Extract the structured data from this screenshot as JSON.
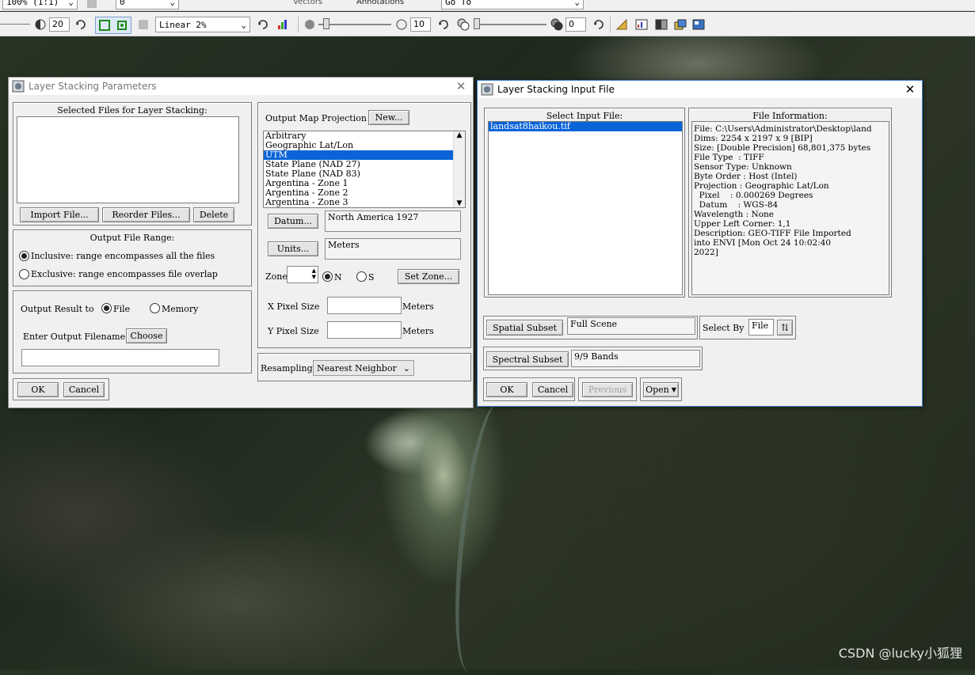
{
  "toolbar_top": {
    "zoom_value": "100% (1:1)",
    "field_value": "0",
    "vectors_label": "Vectors",
    "annotations_label": "Annotations",
    "goto_value": "Go To"
  },
  "toolbar": {
    "brightness_value": "20",
    "stretch_value": "Linear 2%",
    "sharpen_value": "10",
    "transparency_value": "0"
  },
  "params_window": {
    "title": "Layer Stacking Parameters",
    "selected_files_label": "Selected Files for Layer Stacking:",
    "import_button": "Import File...",
    "reorder_button": "Reorder Files...",
    "delete_button": "Delete",
    "output_range_label": "Output File Range:",
    "inclusive_label": "Inclusive: range encompasses all the files",
    "exclusive_label": "Exclusive: range encompasses file overlap",
    "output_result_label": "Output Result to",
    "file_label": "File",
    "memory_label": "Memory",
    "enter_filename_label": "Enter Output Filename",
    "choose_button": "Choose",
    "projection_label": "Output Map Projection",
    "new_button": "New...",
    "projections": [
      "Arbitrary",
      "Geographic Lat/Lon",
      "UTM",
      "State Plane (NAD 27)",
      "State Plane (NAD 83)",
      "Argentina - Zone 1",
      "Argentina - Zone 2",
      "Argentina - Zone 3"
    ],
    "datum_button": "Datum...",
    "datum_value": "North America 1927",
    "units_button": "Units...",
    "units_value": "Meters",
    "zone_label": "Zone",
    "n_label": "N",
    "s_label": "S",
    "set_zone_button": "Set Zone...",
    "x_pixel_label": "X Pixel Size",
    "y_pixel_label": "Y Pixel Size",
    "meters_label": "Meters",
    "resampling_label": "Resampling",
    "resampling_value": "Nearest Neighbor",
    "ok_button": "OK",
    "cancel_button": "Cancel"
  },
  "input_window": {
    "title": "Layer Stacking Input File",
    "select_input_label": "Select Input File:",
    "files": [
      "landsat8haikou.tif"
    ],
    "file_info_label": "File Information:",
    "info_lines": [
      "File: C:\\Users\\Administrator\\Desktop\\land",
      "Dims: 2254 x 2197 x 9 [BIP]",
      "Size: [Double Precision] 68,801,375 bytes",
      "File Type  : TIFF",
      "Sensor Type: Unknown",
      "Byte Order : Host (Intel)",
      "Projection : Geographic Lat/Lon",
      "  Pixel    : 0.000269 Degrees",
      "  Datum    : WGS-84",
      "Wavelength : None",
      "Upper Left Corner: 1,1",
      "Description: GEO-TIFF File Imported",
      "into ENVI [Mon Oct 24 10:02:40",
      "2022]"
    ],
    "spatial_subset_button": "Spatial Subset",
    "spatial_subset_value": "Full Scene",
    "select_by_label": "Select By",
    "select_by_value": "File",
    "spectral_subset_button": "Spectral Subset",
    "spectral_subset_value": "9/9 Bands",
    "ok_button": "OK",
    "cancel_button": "Cancel",
    "previous_button": "Previous",
    "open_button": "Open"
  },
  "watermark": "CSDN @lucky小狐狸"
}
